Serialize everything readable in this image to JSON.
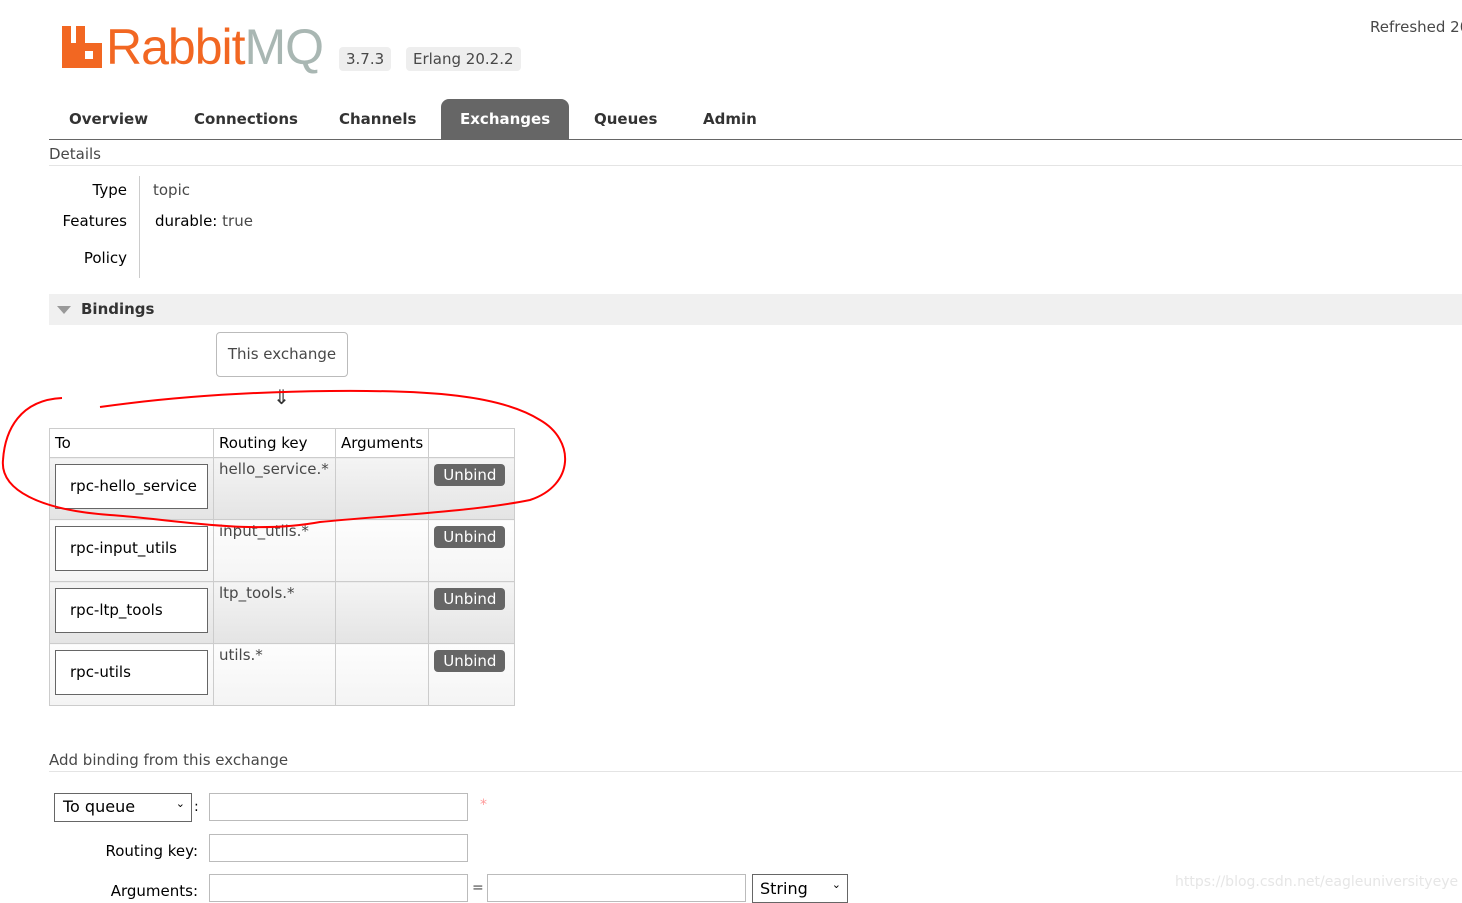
{
  "header": {
    "brand": "RabbitMQ",
    "brand_main": "Rabbit",
    "brand_suffix": "MQ",
    "version": "3.7.3",
    "erlang": "Erlang 20.2.2",
    "refreshed": "Refreshed 20"
  },
  "nav": [
    {
      "label": "Overview"
    },
    {
      "label": "Connections"
    },
    {
      "label": "Channels"
    },
    {
      "label": "Exchanges",
      "active": true
    },
    {
      "label": "Queues"
    },
    {
      "label": "Admin"
    }
  ],
  "details": {
    "title": "Details",
    "type_label": "Type",
    "type_value": "topic",
    "features_label": "Features",
    "features_key": "durable:",
    "features_value": "true",
    "policy_label": "Policy"
  },
  "bindings": {
    "title": "Bindings",
    "this_exchange": "This exchange",
    "arrow": "⇓",
    "columns": [
      "To",
      "Routing key",
      "Arguments",
      ""
    ],
    "rows": [
      {
        "to": "rpc-hello_service",
        "routing_key": "hello_service.*",
        "action": "Unbind"
      },
      {
        "to": "rpc-input_utils",
        "routing_key": "input_utils.*",
        "action": "Unbind"
      },
      {
        "to": "rpc-ltp_tools",
        "routing_key": "ltp_tools.*",
        "action": "Unbind"
      },
      {
        "to": "rpc-utils",
        "routing_key": "utils.*",
        "action": "Unbind"
      }
    ]
  },
  "add_binding": {
    "title": "Add binding from this exchange",
    "destination_type": "To queue",
    "routing_key_label": "Routing key:",
    "arguments_label": "Arguments:",
    "arg_type": "String",
    "required_mark": "*",
    "colon": ":",
    "equals": "="
  },
  "watermark": "https://blog.csdn.net/eagleuniversityeye",
  "colors": {
    "brand_orange": "#f26722",
    "annotation_red": "#ff0000",
    "active_tab": "#666666"
  }
}
